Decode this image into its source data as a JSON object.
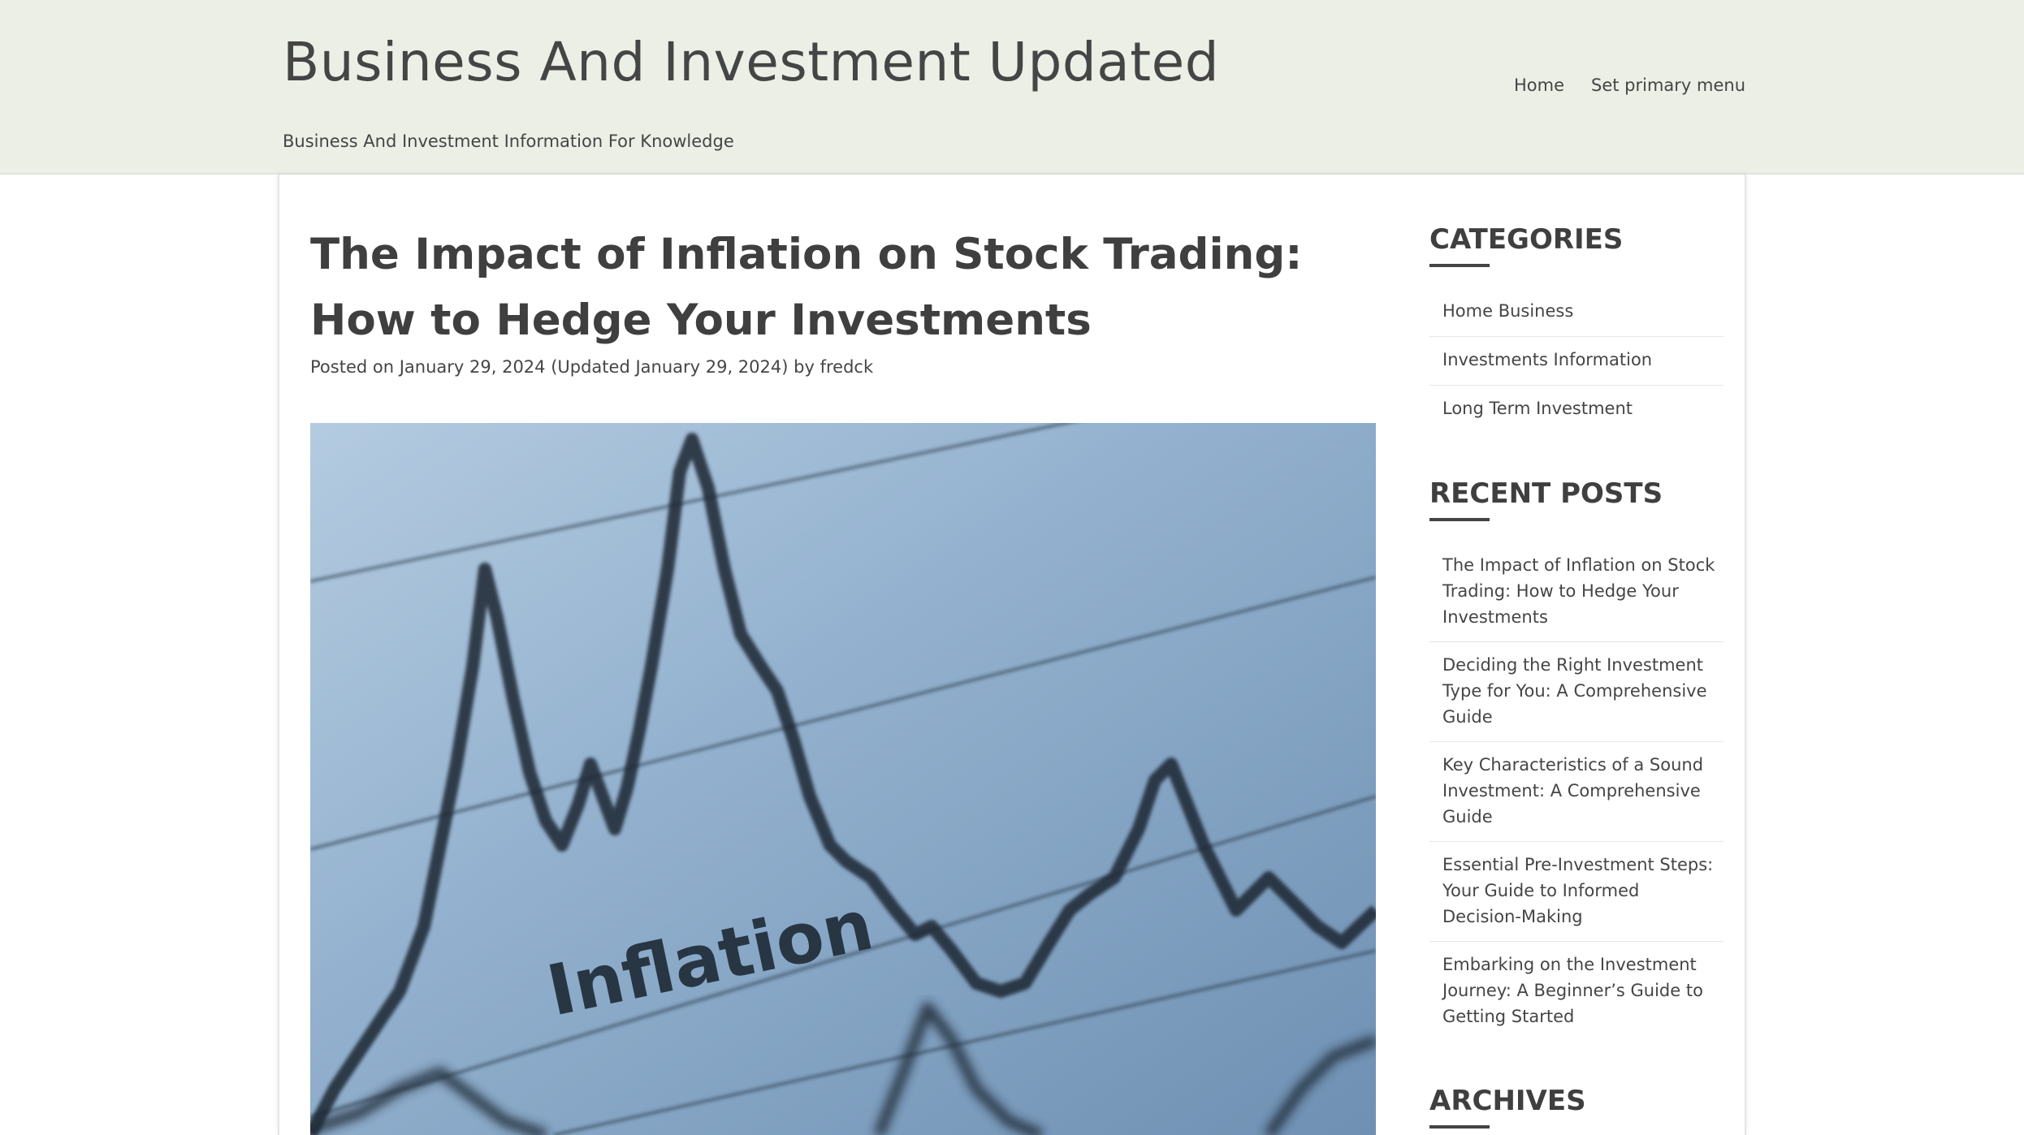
{
  "header": {
    "site_title": "Business And Investment Updated",
    "site_description": "Business And Investment Information For Knowledge",
    "nav": [
      {
        "label": "Home"
      },
      {
        "label": "Set primary menu"
      }
    ]
  },
  "article": {
    "title": "The Impact of Inflation on Stock Trading: How to Hedge Your Investments",
    "meta_prefix": "Posted on",
    "meta_date": "January 29, 2024 (Updated January 29, 2024)",
    "meta_by": "by",
    "meta_author": "fredck",
    "image_text": "Inflation"
  },
  "sidebar": {
    "categories_title": "CATEGORIES",
    "categories": [
      {
        "label": "Home Business"
      },
      {
        "label": "Investments Information"
      },
      {
        "label": "Long Term Investment"
      }
    ],
    "recent_posts_title": "RECENT POSTS",
    "recent_posts": [
      {
        "label": "The Impact of Inflation on Stock Trading: How to Hedge Your Investments"
      },
      {
        "label": "Deciding the Right Investment Type for You: A Comprehensive Guide"
      },
      {
        "label": "Key Characteristics of a Sound Investment: A Comprehensive Guide"
      },
      {
        "label": "Essential Pre-Investment Steps: Your Guide to Informed Decision-Making"
      },
      {
        "label": "Embarking on the Investment Journey: A Beginner’s Guide to Getting Started"
      }
    ],
    "archives_title": "ARCHIVES"
  },
  "colors": {
    "header_bg": "#ebefe6",
    "text": "#454545",
    "image_blue": "#8faecb"
  }
}
